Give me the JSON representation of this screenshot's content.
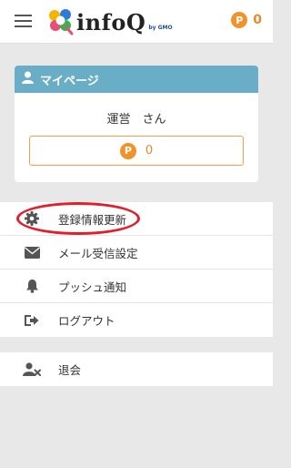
{
  "header": {
    "logo_text": "infoQ",
    "logo_sub": "by GMO",
    "points_badge": "P",
    "points_value": "0"
  },
  "mypage": {
    "title": "マイページ",
    "user_name": "運営　さん",
    "points_badge": "P",
    "points_value": "0"
  },
  "menu": {
    "items": [
      {
        "label": "登録情報更新",
        "icon": "gear-icon"
      },
      {
        "label": "メール受信設定",
        "icon": "envelope-icon"
      },
      {
        "label": "プッシュ通知",
        "icon": "bell-icon"
      },
      {
        "label": "ログアウト",
        "icon": "logout-icon"
      }
    ]
  },
  "menu2": {
    "items": [
      {
        "label": "退会",
        "icon": "user-remove-icon"
      }
    ]
  },
  "colors": {
    "accent_orange": "#f0932b",
    "card_header": "#69adc7",
    "highlight_red": "#e41d2a"
  }
}
